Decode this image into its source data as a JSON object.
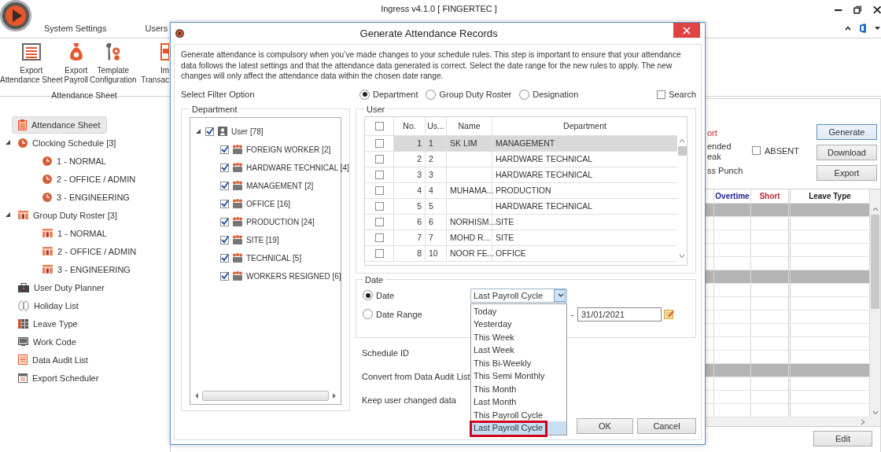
{
  "window": {
    "title": "Ingress v4.1.0 [ FINGERTEC ]"
  },
  "menu_tabs": [
    "System Settings",
    "Users"
  ],
  "ribbon": {
    "buttons": [
      {
        "kind": "sheet",
        "lines": [
          "Export",
          "Attendance Sheet"
        ]
      },
      {
        "kind": "bag",
        "lines": [
          "Export",
          "Payroll"
        ]
      },
      {
        "kind": "tools",
        "lines": [
          "Template",
          "Configuration"
        ]
      },
      {
        "kind": "import",
        "lines": [
          "Im",
          "Transac"
        ]
      }
    ],
    "group_label": "Attendance Sheet"
  },
  "sidebar": {
    "items": [
      {
        "label": "Attendance Sheet",
        "kind": "sheet",
        "selected": true
      },
      {
        "label": "Clocking Schedule [3]",
        "kind": "clock",
        "selected": false,
        "expanded": true,
        "children": [
          {
            "label": "1 - NORMAL",
            "kind": "clock",
            "selected": false
          },
          {
            "label": "2 - OFFICE / ADMIN",
            "kind": "clock",
            "selected": false
          },
          {
            "label": "3 - ENGINEERING",
            "kind": "clock",
            "selected": false
          }
        ]
      },
      {
        "label": "Group Duty Roster [3]",
        "kind": "roster",
        "selected": false,
        "expanded": true,
        "children": [
          {
            "label": "1 - NORMAL",
            "kind": "roster",
            "selected": false
          },
          {
            "label": "2 - OFFICE / ADMIN",
            "kind": "roster",
            "selected": false
          },
          {
            "label": "3 - ENGINEERING",
            "kind": "roster",
            "selected": false
          }
        ]
      },
      {
        "label": "User Duty Planner",
        "kind": "planner",
        "selected": false
      },
      {
        "label": "Holiday List",
        "kind": "holiday",
        "selected": false
      },
      {
        "label": "Leave Type",
        "kind": "leave",
        "selected": false
      },
      {
        "label": "Work Code",
        "kind": "code",
        "selected": false
      },
      {
        "label": "Data Audit List",
        "kind": "audit",
        "selected": false
      },
      {
        "label": "Export Scheduler",
        "kind": "scheduler",
        "selected": false
      }
    ]
  },
  "report_panel": {
    "legend_items": [
      {
        "lines": [
          "ort"
        ],
        "kind": "alert"
      },
      {
        "lines": [
          "ended",
          "eak"
        ],
        "kind": "plain"
      },
      {
        "lines": [
          "ss Punch"
        ],
        "kind": "plain"
      }
    ],
    "absent_checkbox": {
      "label": "ABSENT",
      "checked": false
    },
    "buttons": [
      {
        "label": "Generate",
        "focused": true
      },
      {
        "label": "Download",
        "focused": false
      },
      {
        "label": "Export",
        "focused": false
      }
    ],
    "table": {
      "columns": [
        {
          "label": "Overtime",
          "color": "#22229a"
        },
        {
          "label": "Short",
          "color": "#c0272d"
        },
        {
          "label": "Leave Type",
          "color": "#222222"
        }
      ],
      "rows": [
        {
          "shaded": true
        },
        {
          "shaded": false
        },
        {
          "shaded": false
        },
        {
          "shaded": false
        },
        {
          "shaded": false
        },
        {
          "shaded": true
        },
        {
          "shaded": false
        },
        {
          "shaded": false
        },
        {
          "shaded": false
        },
        {
          "shaded": false
        },
        {
          "shaded": false
        },
        {
          "shaded": false
        },
        {
          "shaded": true
        },
        {
          "shaded": false
        },
        {
          "shaded": false
        },
        {
          "shaded": false
        }
      ]
    },
    "edit_button": "Edit"
  },
  "dialog": {
    "title": "Generate Attendance Records",
    "description": "Generate attendance is compulsory when you’ve made changes to your schedule rules. This step is important to ensure that your attendance data follows the latest settings and that the attendance data generated is correct. Select the date range for the new rules to apply. The new changes will only affect the attendance data within the chosen date range.",
    "filter_label": "Select Filter Option",
    "filter_options": [
      {
        "label": "Department",
        "selected": true
      },
      {
        "label": "Group Duty Roster",
        "selected": false
      },
      {
        "label": "Designation",
        "selected": false
      }
    ],
    "search": {
      "label": "Search",
      "checked": false
    },
    "department_panel": {
      "legend": "Department",
      "tree": {
        "label": "User [78]",
        "checked": true,
        "expanded": true,
        "children": [
          {
            "label": "FOREIGN WORKER [2]",
            "checked": true
          },
          {
            "label": "HARDWARE TECHNICAL [4]",
            "checked": true
          },
          {
            "label": "MANAGEMENT [2]",
            "checked": true
          },
          {
            "label": "OFFICE [16]",
            "checked": true
          },
          {
            "label": "PRODUCTION [24]",
            "checked": true
          },
          {
            "label": "SITE [19]",
            "checked": true
          },
          {
            "label": "TECHNICAL [5]",
            "checked": true
          },
          {
            "label": "WORKERS RESIGNED [6]",
            "checked": true
          }
        ]
      }
    },
    "user_panel": {
      "legend": "User",
      "header_checked": false,
      "columns": [
        "No.",
        "Us...",
        "Name",
        "Department"
      ],
      "rows": [
        {
          "no": "1",
          "user_id": "1",
          "name": "SK LIM",
          "department": "MANAGEMENT",
          "checked": false,
          "selected": true
        },
        {
          "no": "2",
          "user_id": "2",
          "department": "HARDWARE TECHNICAL",
          "checked": false,
          "selected": false
        },
        {
          "no": "3",
          "user_id": "3",
          "department": "HARDWARE TECHNICAL",
          "checked": false,
          "selected": false
        },
        {
          "no": "4",
          "user_id": "4",
          "name": "MUHAMA...",
          "department": "PRODUCTION",
          "checked": false,
          "selected": false
        },
        {
          "no": "5",
          "user_id": "5",
          "department": "HARDWARE TECHNICAL",
          "checked": false,
          "selected": false
        },
        {
          "no": "6",
          "user_id": "6",
          "name": "NORHISM...",
          "department": "SITE",
          "checked": false,
          "selected": false
        },
        {
          "no": "7",
          "user_id": "7",
          "name": "MOHD R...",
          "department": "SITE",
          "checked": false,
          "selected": false
        },
        {
          "no": "8",
          "user_id": "10",
          "name": "NOOR FE...",
          "department": "OFFICE",
          "checked": false,
          "selected": false
        }
      ]
    },
    "date_panel": {
      "legend": "Date",
      "modes": [
        {
          "label": "Date",
          "selected": true
        },
        {
          "label": "Date Range",
          "selected": false
        }
      ],
      "preset": {
        "value": "Last Payroll Cycle",
        "expanded": true,
        "options": [
          {
            "label": "Today",
            "selected": false,
            "highlighted": false
          },
          {
            "label": "Yesterday",
            "selected": false,
            "highlighted": false
          },
          {
            "label": "This Week",
            "selected": false,
            "highlighted": false
          },
          {
            "label": "Last Week",
            "selected": false,
            "highlighted": false
          },
          {
            "label": "This Bi-Weekly",
            "selected": false,
            "highlighted": false
          },
          {
            "label": "This Semi Monthly",
            "selected": false,
            "highlighted": false
          },
          {
            "label": "This Month",
            "selected": false,
            "highlighted": false
          },
          {
            "label": "Last Month",
            "selected": false,
            "highlighted": false
          },
          {
            "label": "This Payroll Cycle",
            "selected": false,
            "highlighted": false
          },
          {
            "label": "Last Payroll Cycle",
            "selected": true,
            "highlighted": true
          }
        ]
      },
      "range_separator": "-",
      "end_date": "31/01/2021"
    },
    "option_labels": [
      "Schedule ID",
      "Convert from Data Audit List",
      "Keep user changed data"
    ],
    "buttons": [
      "OK",
      "Cancel"
    ]
  }
}
